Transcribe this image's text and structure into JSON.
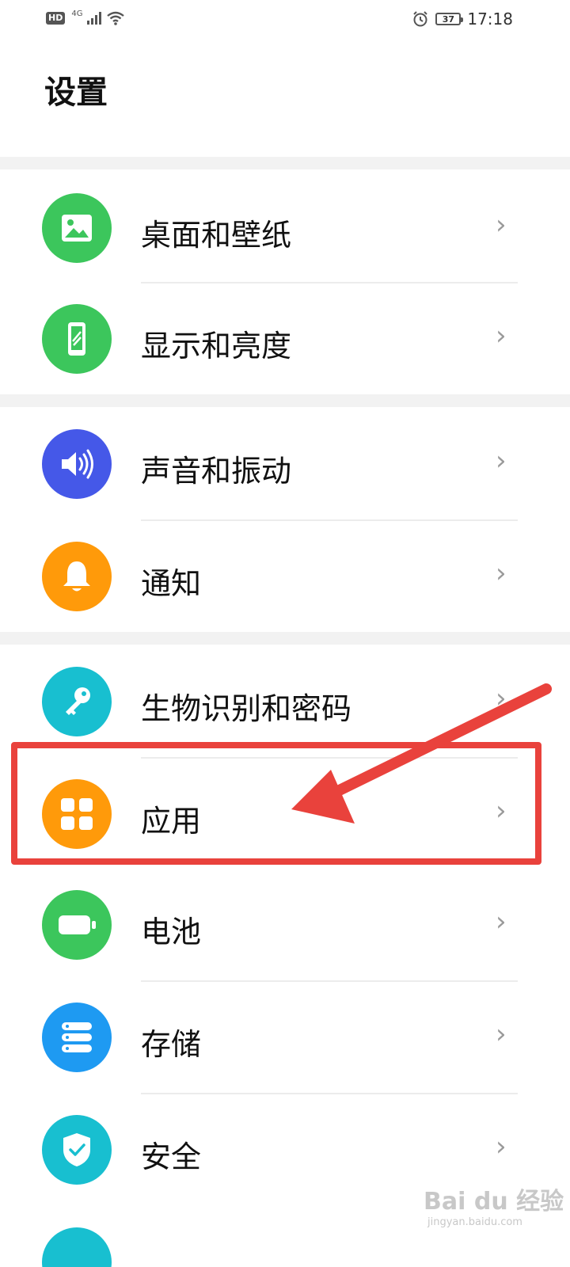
{
  "status_bar": {
    "hd": "HD",
    "network": "4G",
    "battery_level": "37",
    "time": "17:18"
  },
  "page_title": "设置",
  "colors": {
    "green": "#3cc65c",
    "blue": "#4558e8",
    "orange": "#ff9a0a",
    "teal": "#18bfd0",
    "sky": "#1e9af2",
    "annotation_red": "#e9423c"
  },
  "items": [
    {
      "label": "桌面和壁纸",
      "icon": "wallpaper-icon"
    },
    {
      "label": "显示和亮度",
      "icon": "display-icon"
    },
    {
      "label": "声音和振动",
      "icon": "sound-icon"
    },
    {
      "label": "通知",
      "icon": "bell-icon"
    },
    {
      "label": "生物识别和密码",
      "icon": "key-icon"
    },
    {
      "label": "应用",
      "icon": "apps-grid-icon"
    },
    {
      "label": "电池",
      "icon": "battery-icon"
    },
    {
      "label": "存储",
      "icon": "storage-icon"
    },
    {
      "label": "安全",
      "icon": "shield-icon"
    }
  ],
  "chevron": "›",
  "watermark": {
    "text": "Bai du 经验",
    "sub": "jingyan.baidu.com"
  }
}
